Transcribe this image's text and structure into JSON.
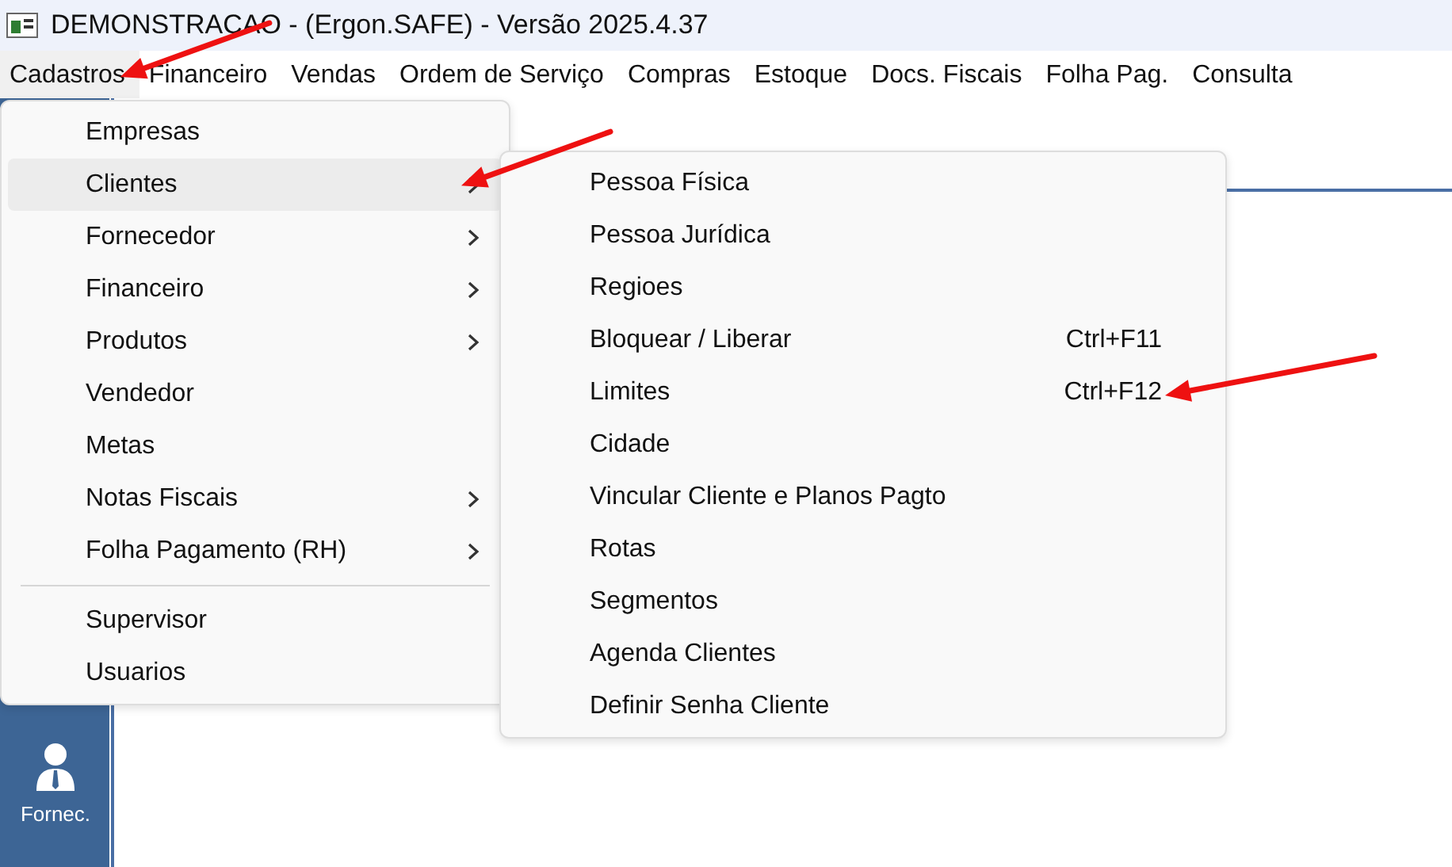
{
  "window": {
    "title": "DEMONSTRACAO - (Ergon.SAFE) - Versão 2025.4.37"
  },
  "menu_bar": [
    {
      "label": "Cadastros",
      "selected": true,
      "arrow": true
    },
    {
      "label": "Financeiro",
      "selected": false,
      "arrow": false
    },
    {
      "label": "Vendas",
      "selected": false,
      "arrow": false
    },
    {
      "label": "Ordem de Serviço",
      "selected": false,
      "arrow": false
    },
    {
      "label": "Compras",
      "selected": false,
      "arrow": false
    },
    {
      "label": "Estoque",
      "selected": false,
      "arrow": false
    },
    {
      "label": "Docs. Fiscais",
      "selected": false,
      "arrow": false
    },
    {
      "label": "Folha Pag.",
      "selected": false,
      "arrow": false
    },
    {
      "label": "Consulta",
      "selected": false,
      "arrow": false
    }
  ],
  "menu": [
    {
      "kind": "item",
      "label": "Empresas",
      "submenu": false,
      "selected": false,
      "arrow": false
    },
    {
      "kind": "item",
      "label": "Clientes",
      "submenu": true,
      "selected": true,
      "arrow": true
    },
    {
      "kind": "item",
      "label": "Fornecedor",
      "submenu": true,
      "selected": false,
      "arrow": false
    },
    {
      "kind": "item",
      "label": "Financeiro",
      "submenu": true,
      "selected": false,
      "arrow": false
    },
    {
      "kind": "item",
      "label": "Produtos",
      "submenu": true,
      "selected": false,
      "arrow": false
    },
    {
      "kind": "item",
      "label": "Vendedor",
      "submenu": false,
      "selected": false,
      "arrow": false
    },
    {
      "kind": "item",
      "label": "Metas",
      "submenu": false,
      "selected": false,
      "arrow": false
    },
    {
      "kind": "item",
      "label": "Notas Fiscais",
      "submenu": true,
      "selected": false,
      "arrow": false
    },
    {
      "kind": "item",
      "label": "Folha Pagamento (RH)",
      "submenu": true,
      "selected": false,
      "arrow": false
    },
    {
      "kind": "separator"
    },
    {
      "kind": "item",
      "label": "Supervisor",
      "submenu": false,
      "selected": false,
      "arrow": false
    },
    {
      "kind": "item",
      "label": "Usuarios",
      "submenu": false,
      "selected": false,
      "arrow": false
    }
  ],
  "submenu": [
    {
      "label": "Pessoa Física",
      "arrow": false
    },
    {
      "label": "Pessoa Jurídica",
      "arrow": false
    },
    {
      "label": "Regioes",
      "arrow": false
    },
    {
      "label": "Bloquear / Liberar",
      "shortcut": "Ctrl+F11",
      "arrow": false
    },
    {
      "label": "Limites",
      "shortcut": "Ctrl+F12",
      "arrow": true
    },
    {
      "label": "Cidade",
      "arrow": false
    },
    {
      "label": "Vincular Cliente e Planos Pagto",
      "arrow": false
    },
    {
      "label": "Rotas",
      "arrow": false
    },
    {
      "label": "Segmentos",
      "arrow": false
    },
    {
      "label": "Agenda Clientes",
      "arrow": false
    },
    {
      "label": "Definir Senha Cliente",
      "arrow": false
    }
  ],
  "sidebar": [
    {
      "label": "Fornec."
    }
  ]
}
